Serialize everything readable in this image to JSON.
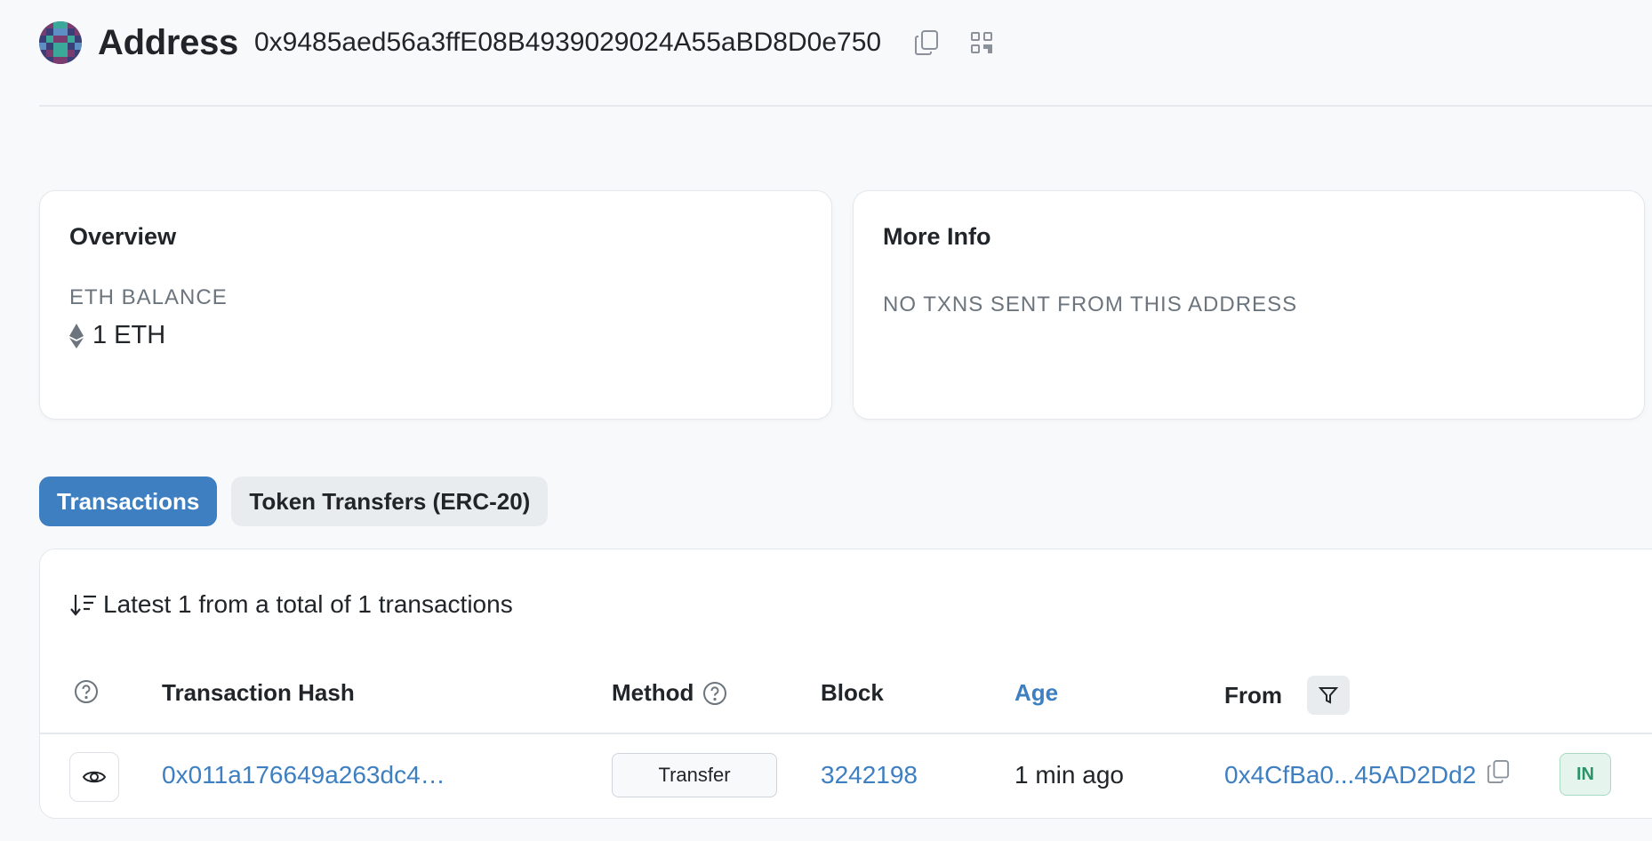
{
  "header": {
    "title": "Address",
    "address": "0x9485aed56a3ffE08B4939029024A55aBD8D0e750",
    "icons": [
      "avatar-identicon",
      "copy-icon",
      "qr-code-icon"
    ]
  },
  "overview": {
    "title": "Overview",
    "eth_balance_label": "ETH BALANCE",
    "eth_balance_value": "1 ETH",
    "eth_icon": "ethereum-icon"
  },
  "more_info": {
    "title": "More Info",
    "status": "NO TXNS SENT FROM THIS ADDRESS"
  },
  "tabs": [
    {
      "label": "Transactions",
      "active": true
    },
    {
      "label": "Token Transfers (ERC-20)",
      "active": false
    }
  ],
  "transactions": {
    "summary": "Latest 1 from a total of 1 transactions",
    "columns": {
      "hash": "Transaction Hash",
      "method": "Method",
      "block": "Block",
      "age": "Age",
      "from": "From"
    },
    "rows": [
      {
        "hash": "0x011a176649a263dc4…",
        "method": "Transfer",
        "block": "3242198",
        "age": "1 min ago",
        "from": "0x4CfBa0...45AD2Dd2",
        "direction": "IN"
      }
    ]
  },
  "colors": {
    "accent": "#3d7fc1",
    "in_badge_text": "#2a9466",
    "in_badge_bg": "#e6f4ee",
    "background": "#f8f9fb"
  }
}
